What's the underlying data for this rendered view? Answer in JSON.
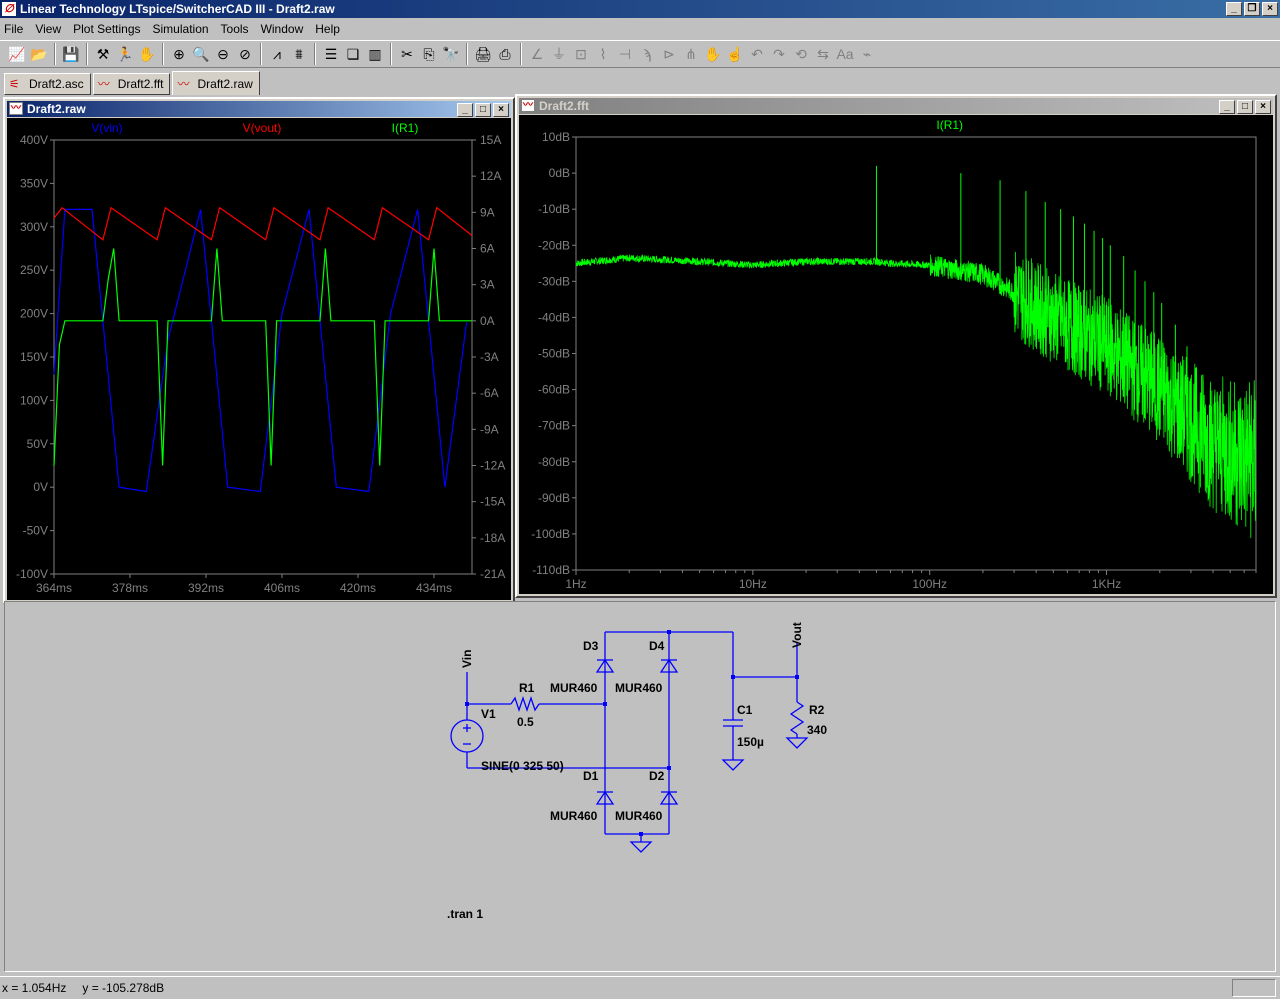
{
  "app": {
    "title": "Linear Technology LTspice/SwitcherCAD III - Draft2.raw",
    "icon": "ltspice-logo-icon"
  },
  "menu": [
    "File",
    "View",
    "Plot Settings",
    "Simulation",
    "Tools",
    "Window",
    "Help"
  ],
  "toolbar_icons": [
    "new-schematic-icon",
    "open-icon",
    "save-icon",
    "hammer-icon",
    "run-icon",
    "hand-icon",
    "zoom-in-icon",
    "zoom-out-icon",
    "zoom-fit-icon",
    "zoom-cancel-icon",
    "autorange-icon",
    "plot-settings-icon",
    "tile-horizontal-icon",
    "cascade-icon",
    "tile-vertical-icon",
    "cut-icon",
    "copy-icon",
    "find-icon",
    "print-icon",
    "print-preview-icon",
    "wire-icon",
    "ground-icon",
    "label-icon",
    "resistor-icon",
    "capacitor-icon",
    "inductor-icon",
    "diode-icon",
    "component-icon",
    "move-icon",
    "drag-icon",
    "undo-icon",
    "redo-icon",
    "rotate-icon",
    "mirror-icon",
    "text-icon",
    "spice-directive-icon"
  ],
  "tabs": [
    {
      "label": "Draft2.asc",
      "icon": "schematic-icon"
    },
    {
      "label": "Draft2.fft",
      "icon": "waveform-icon"
    },
    {
      "label": "Draft2.raw",
      "icon": "waveform-icon"
    }
  ],
  "raw_window": {
    "title": "Draft2.raw",
    "traces": [
      {
        "name": "V(vin)",
        "color": "#0000ff"
      },
      {
        "name": "V(vout)",
        "color": "#ff0000"
      },
      {
        "name": "I(R1)",
        "color": "#00ff00"
      }
    ],
    "left_ticks": [
      "400V",
      "350V",
      "300V",
      "250V",
      "200V",
      "150V",
      "100V",
      "50V",
      "0V",
      "-50V",
      "-100V"
    ],
    "right_ticks": [
      "15A",
      "12A",
      "9A",
      "6A",
      "3A",
      "0A",
      "-3A",
      "-6A",
      "-9A",
      "-12A",
      "-15A",
      "-18A",
      "-21A"
    ],
    "x_ticks": [
      "364ms",
      "378ms",
      "392ms",
      "406ms",
      "420ms",
      "434ms"
    ]
  },
  "fft_window": {
    "title": "Draft2.fft",
    "trace": {
      "name": "I(R1)",
      "color": "#00ff00"
    },
    "y_ticks": [
      "10dB",
      "0dB",
      "-10dB",
      "-20dB",
      "-30dB",
      "-40dB",
      "-50dB",
      "-60dB",
      "-70dB",
      "-80dB",
      "-90dB",
      "-100dB",
      "-110dB"
    ],
    "x_ticks": [
      "1Hz",
      "10Hz",
      "100Hz",
      "1KHz"
    ]
  },
  "schematic": {
    "net_vin": "Vin",
    "net_vout": "Vout",
    "v1": {
      "name": "V1",
      "value": "SINE(0 325 50)"
    },
    "r1": {
      "name": "R1",
      "value": "0.5"
    },
    "r2": {
      "name": "R2",
      "value": "340"
    },
    "c1": {
      "name": "C1",
      "value": "150µ"
    },
    "d1": {
      "name": "D1",
      "value": "MUR460"
    },
    "d2": {
      "name": "D2",
      "value": "MUR460"
    },
    "d3": {
      "name": "D3",
      "value": "MUR460"
    },
    "d4": {
      "name": "D4",
      "value": "MUR460"
    },
    "directive": ".tran 1"
  },
  "status": {
    "x": "x = 1.054Hz",
    "y": "y = -105.278dB"
  },
  "chart_data": [
    {
      "type": "line",
      "title": "",
      "x_unit": "ms",
      "xlim": [
        364,
        441
      ],
      "ylim_left": [
        -100,
        400
      ],
      "ylim_right": [
        -21,
        15
      ],
      "series": [
        {
          "name": "V(vin)",
          "axis": "left",
          "description_points": [
            [
              364,
              130
            ],
            [
              366,
              320
            ],
            [
              371,
              320
            ],
            [
              376,
              0
            ],
            [
              381,
              -5
            ],
            [
              385,
              170
            ],
            [
              391,
              320
            ],
            [
              396,
              0
            ],
            [
              402,
              -5
            ],
            [
              406,
              200
            ],
            [
              411,
              320
            ],
            [
              416,
              0
            ],
            [
              422,
              -5
            ],
            [
              426,
              200
            ],
            [
              431,
              320
            ],
            [
              436,
              0
            ],
            [
              440,
              190
            ]
          ]
        },
        {
          "name": "V(vout)",
          "axis": "left",
          "points": [
            [
              364,
              310
            ],
            [
              365.5,
              322
            ],
            [
              373,
              285
            ],
            [
              374.5,
              322
            ],
            [
              383,
              285
            ],
            [
              384.5,
              322
            ],
            [
              393,
              285
            ],
            [
              394.5,
              322
            ],
            [
              403,
              285
            ],
            [
              404.5,
              322
            ],
            [
              413,
              285
            ],
            [
              414.5,
              322
            ],
            [
              423,
              285
            ],
            [
              424.5,
              322
            ],
            [
              433,
              285
            ],
            [
              434.5,
              322
            ],
            [
              441,
              290
            ]
          ]
        },
        {
          "name": "I(R1)",
          "axis": "right",
          "points": [
            [
              364,
              -12
            ],
            [
              365,
              -2
            ],
            [
              366,
              0
            ],
            [
              373,
              0
            ],
            [
              374,
              3.5
            ],
            [
              375,
              6
            ],
            [
              376,
              0
            ],
            [
              383,
              0
            ],
            [
              384,
              -12
            ],
            [
              385,
              0
            ],
            [
              393,
              0
            ],
            [
              394,
              6
            ],
            [
              395,
              0
            ],
            [
              403,
              0
            ],
            [
              404,
              -12
            ],
            [
              405,
              0
            ],
            [
              413,
              0
            ],
            [
              414,
              6
            ],
            [
              415,
              0
            ],
            [
              423,
              0
            ],
            [
              424,
              -12
            ],
            [
              425,
              0
            ],
            [
              433,
              0
            ],
            [
              434,
              6
            ],
            [
              435,
              0
            ],
            [
              441,
              0
            ]
          ]
        }
      ]
    },
    {
      "type": "line",
      "title": "",
      "xscale": "log",
      "xlim": [
        1,
        7000
      ],
      "ylim": [
        -110,
        10
      ],
      "series": [
        {
          "name": "I(R1)",
          "points": [
            [
              1,
              -25
            ],
            [
              2,
              -23.5
            ],
            [
              5,
              -24.5
            ],
            [
              10,
              -25.5
            ],
            [
              20,
              -24.5
            ],
            [
              50,
              -24.5
            ],
            [
              60,
              -25
            ],
            [
              100,
              -25.5
            ],
            [
              200,
              -28
            ],
            [
              300,
              -33
            ],
            [
              500,
              -40
            ],
            [
              1000,
              -48
            ],
            [
              2000,
              -60
            ],
            [
              4000,
              -75
            ],
            [
              7000,
              -80
            ]
          ],
          "peaks": [
            [
              50,
              2
            ],
            [
              150,
              0
            ],
            [
              250,
              -2
            ],
            [
              350,
              -5
            ],
            [
              450,
              -8
            ],
            [
              550,
              -10
            ],
            [
              650,
              -12
            ],
            [
              750,
              -14
            ],
            [
              850,
              -16
            ],
            [
              950,
              -18
            ],
            [
              1050,
              -20
            ],
            [
              1250,
              -23
            ],
            [
              1450,
              -27
            ],
            [
              1650,
              -30
            ],
            [
              1850,
              -33
            ],
            [
              2050,
              -36
            ],
            [
              2450,
              -42
            ],
            [
              2850,
              -48
            ],
            [
              3450,
              -56
            ],
            [
              4050,
              -64
            ],
            [
              4650,
              -70
            ],
            [
              5450,
              -76
            ]
          ]
        }
      ]
    }
  ]
}
